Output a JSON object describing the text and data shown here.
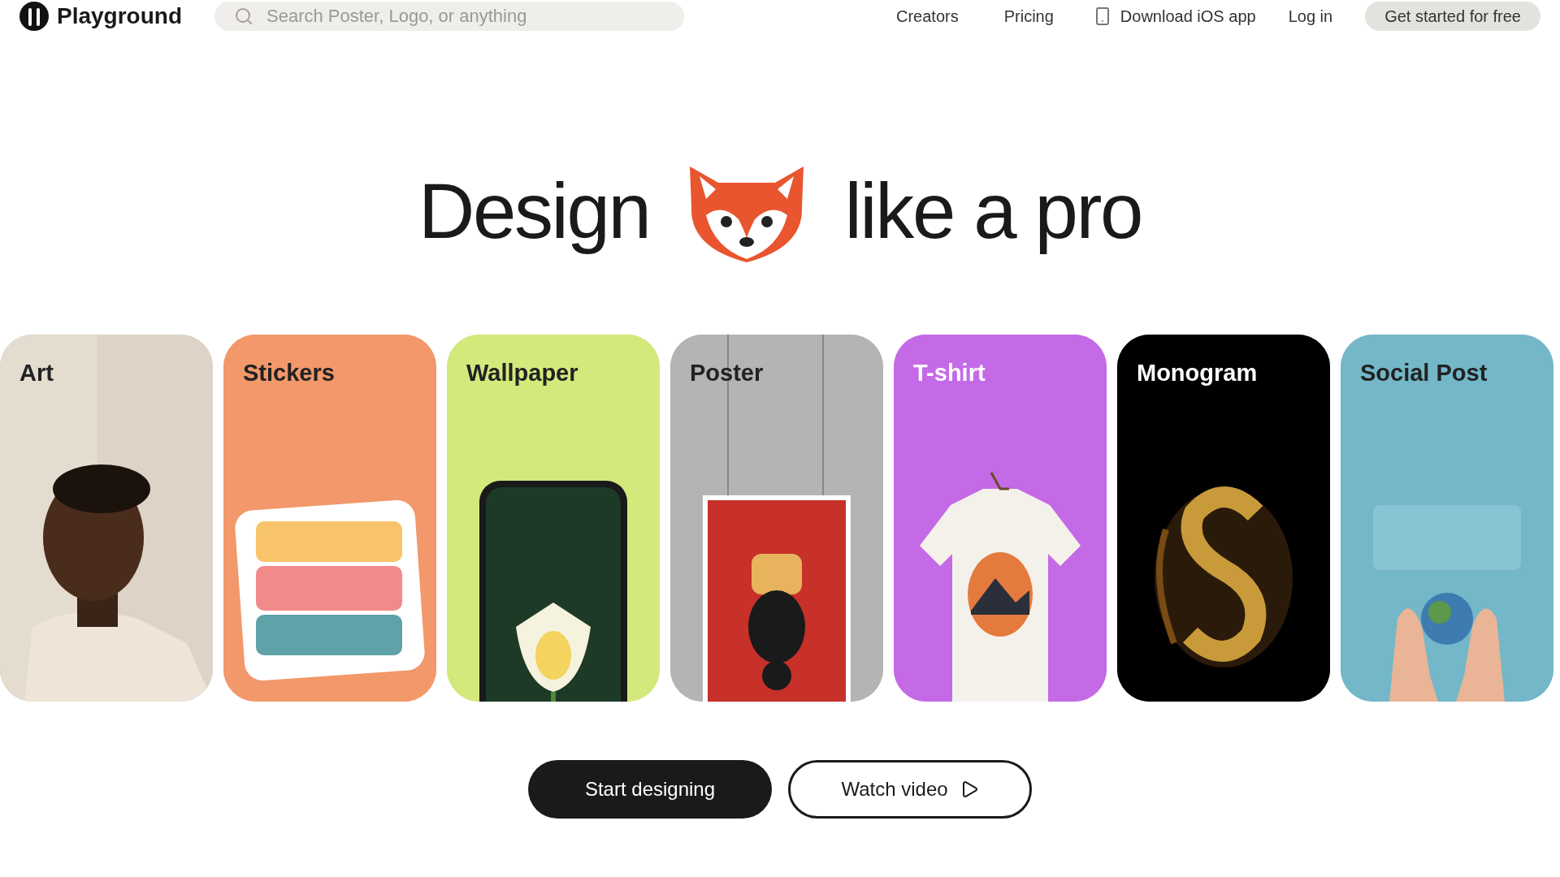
{
  "header": {
    "brand": "Playground",
    "search": {
      "placeholder": "Search Poster, Logo, or anything"
    },
    "nav": [
      "Creators",
      "Pricing"
    ],
    "app_link": "Download iOS app",
    "login": "Log in",
    "cta": "Get started for free"
  },
  "hero": {
    "before": "Design",
    "after": "like a pro"
  },
  "cards": [
    {
      "label": "Art",
      "color": "#d8cfc4"
    },
    {
      "label": "Stickers",
      "color": "#f0976a"
    },
    {
      "label": "Wallpaper",
      "color": "#d4e87a"
    },
    {
      "label": "Poster",
      "color": "#b3b3b3"
    },
    {
      "label": "T-shirt",
      "color": "#c468e6"
    },
    {
      "label": "Monogram",
      "color": "#000000"
    },
    {
      "label": "Social Post",
      "color": "#72b6c8"
    }
  ],
  "buttons": {
    "primary": "Start designing",
    "secondary": "Watch video"
  }
}
